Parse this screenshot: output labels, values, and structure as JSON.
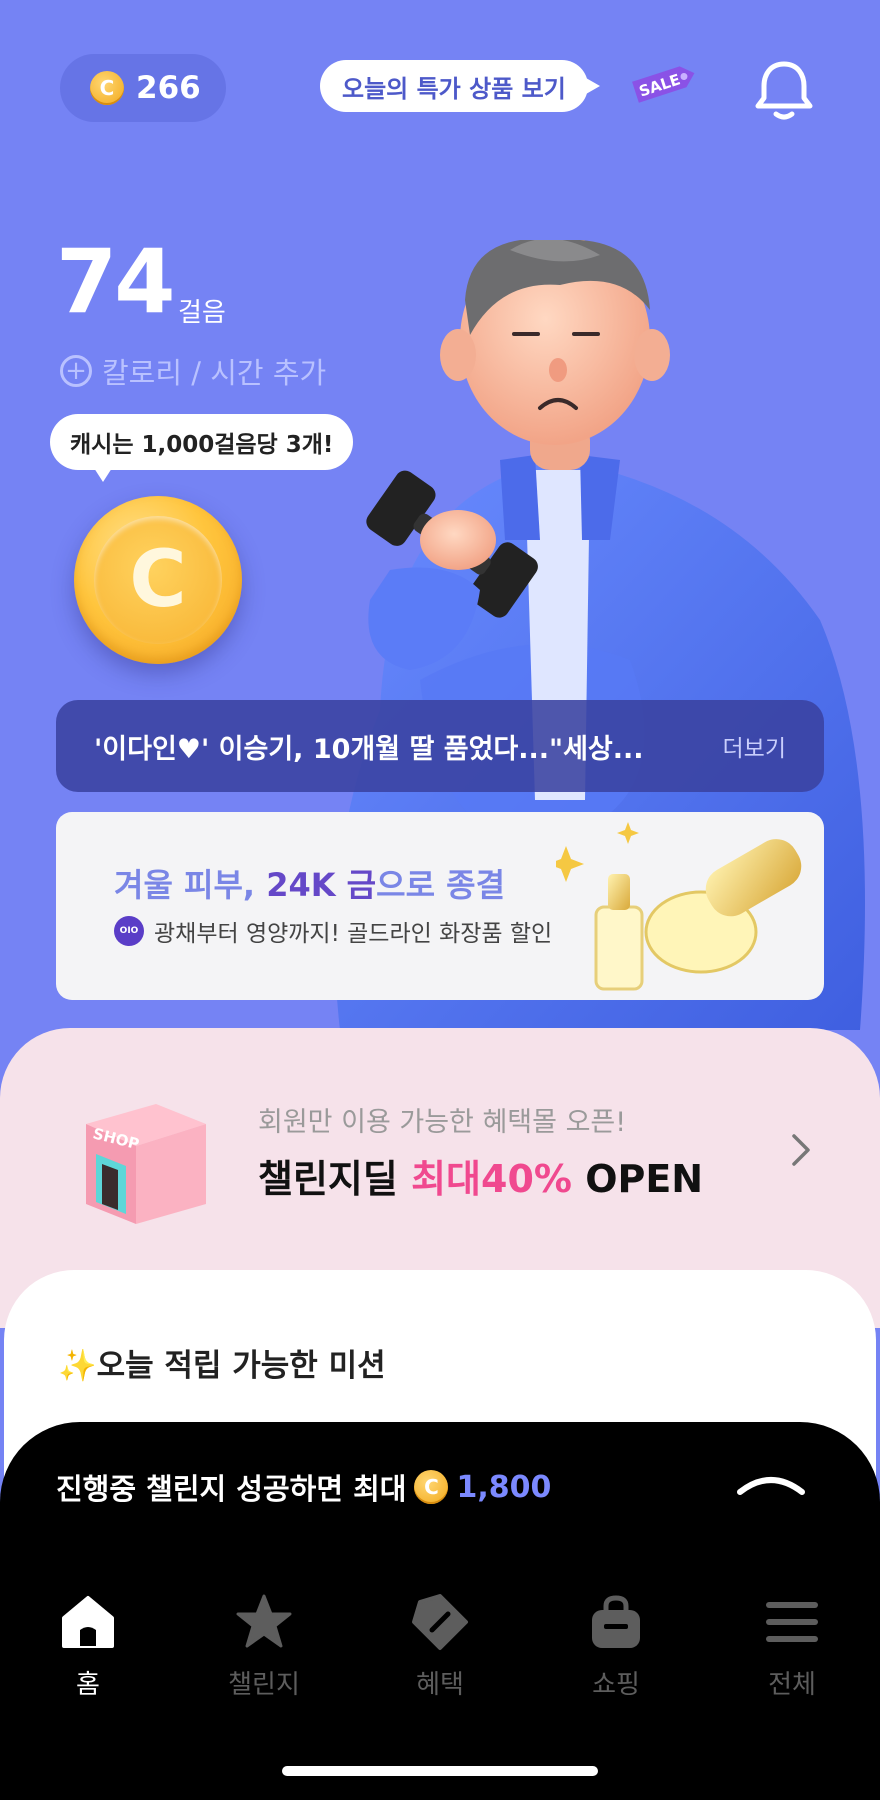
{
  "header": {
    "coin_icon": "C",
    "coin_count": "266",
    "deal_label": "오늘의 특가 상품 보기",
    "sale_tag": "SALE",
    "bell_icon": "bell-icon"
  },
  "steps": {
    "count": "74",
    "unit": "걸음",
    "add_label": "칼로리 / 시간 추가",
    "tip": "캐시는 1,000걸음당 3개!",
    "coin_letter": "C"
  },
  "news": {
    "headline": "'이다인♥' 이승기, 10개월 딸 품었다...\"세상...",
    "more": "더보기"
  },
  "ad": {
    "title_pre": "겨울 피부, ",
    "title_hl": "24K 금",
    "title_post": "으로 종결",
    "badge": "OIO",
    "subtitle": "광채부터 영양까지! 골드라인 화장품 할인"
  },
  "promo": {
    "subtitle": "회원만 이용 가능한 혜택몰 오픈!",
    "title_pre": "챌린지딜 ",
    "title_hl": "최대40%",
    "title_post": " OPEN",
    "shop_sign": "SHOP"
  },
  "missions": {
    "title": "✨오늘 적립 가능한 미션"
  },
  "challenge": {
    "text": "진행중 챌린지 성공하면 최대",
    "coin_icon": "C",
    "amount": "1,800"
  },
  "tabs": [
    {
      "label": "홈",
      "icon": "home-icon",
      "active": true
    },
    {
      "label": "챌린지",
      "icon": "star-icon"
    },
    {
      "label": "혜택",
      "icon": "tag-icon"
    },
    {
      "label": "쇼핑",
      "icon": "bag-icon"
    },
    {
      "label": "전체",
      "icon": "menu-icon"
    }
  ],
  "colors": {
    "background": "#7583f4",
    "accent_blue": "#7b89ff",
    "accent_pink": "#f0498f",
    "coin_gold": "#f5a623"
  }
}
